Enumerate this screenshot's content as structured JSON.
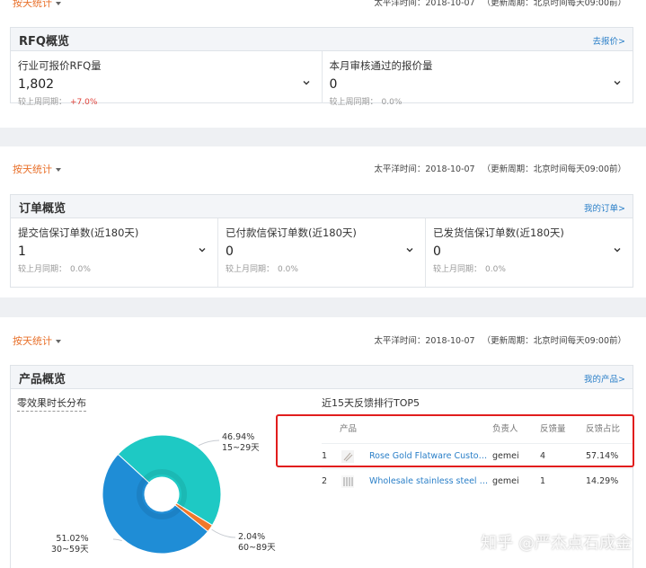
{
  "section1": {
    "filter_label": "按天统计",
    "meta_time": "太平洋时间：2018-10-07",
    "meta_cycle": "（更新周期：北京时间每天09:00前）",
    "card": {
      "title": "RFQ概览",
      "link": "去报价>",
      "metrics": [
        {
          "label": "行业可报价RFQ量",
          "value": "1,802",
          "compare_label": "较上周同期：",
          "compare_value": "+7.0%"
        },
        {
          "label": "本月审核通过的报价量",
          "value": "0",
          "compare_label": "较上周同期：",
          "compare_value": "0.0%"
        }
      ]
    }
  },
  "section2": {
    "filter_label": "按天统计",
    "meta_time": "太平洋时间：2018-10-07",
    "meta_cycle": "（更新周期：北京时间每天09:00前）",
    "card": {
      "title": "订单概览",
      "link": "我的订单>",
      "metrics": [
        {
          "label": "提交信保订单数(近180天)",
          "value": "1",
          "compare_label": "较上月同期：",
          "compare_value": "0.0%"
        },
        {
          "label": "已付款信保订单数(近180天)",
          "value": "0",
          "compare_label": "较上月同期：",
          "compare_value": "0.0%"
        },
        {
          "label": "已发货信保订单数(近180天)",
          "value": "0",
          "compare_label": "较上月同期：",
          "compare_value": "0.0%"
        }
      ]
    }
  },
  "section3": {
    "filter_label": "按天统计",
    "meta_time": "太平洋时间：2018-10-07",
    "meta_cycle": "（更新周期：北京时间每天09:00前）",
    "card": {
      "title": "产品概览",
      "link": "我的产品>",
      "pie_title": "零效果时长分布",
      "table_title": "近15天反馈排行TOP5",
      "table_headers": {
        "product": "产品",
        "owner": "负责人",
        "count": "反馈量",
        "ratio": "反馈占比"
      },
      "table_rows": [
        {
          "rank": "1",
          "name": "Rose Gold Flatware Customiza...",
          "owner": "gemei",
          "count": "4",
          "ratio": "57.14%"
        },
        {
          "rank": "2",
          "name": "Wholesale stainless steel flatw...",
          "owner": "gemei",
          "count": "1",
          "ratio": "14.29%"
        }
      ]
    }
  },
  "chart_data": {
    "type": "pie",
    "title": "零效果时长分布",
    "donut": true,
    "slices": [
      {
        "label": "15~29天",
        "percent": 46.94,
        "display": "46.94%",
        "color": "#1ec9c4"
      },
      {
        "label": "60~89天",
        "percent": 2.04,
        "display": "2.04%",
        "color": "#f0782b"
      },
      {
        "label": "30~59天",
        "percent": 51.02,
        "display": "51.02%",
        "color": "#1f8dd6"
      }
    ]
  },
  "watermark": "知乎 @严杰点石成金",
  "colors": {
    "accent_orange": "#e8702a",
    "link_blue": "#2a7fc8",
    "highlight_red": "#e11d1d",
    "positive_red": "#e0433b"
  },
  "icons": {
    "filter_caret": "caret-down-icon",
    "metric_expand": "chevron-down-icon",
    "product_thumb": "flatware-thumbnail"
  }
}
